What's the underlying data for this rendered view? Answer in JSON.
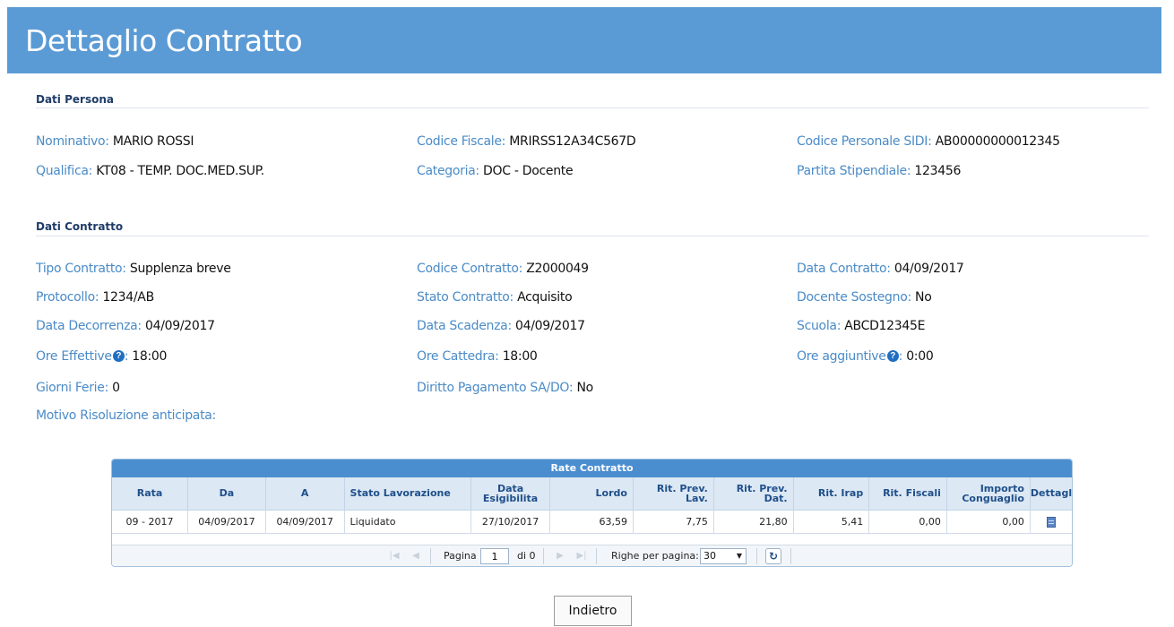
{
  "header": {
    "title": "Dettaglio Contratto"
  },
  "persona": {
    "section_title": "Dati Persona",
    "nominativo": {
      "label": "Nominativo:",
      "value": "MARIO ROSSI"
    },
    "codice_fiscale": {
      "label": "Codice Fiscale:",
      "value": "MRIRSS12A34C567D"
    },
    "codice_sidi": {
      "label": "Codice Personale SIDI:",
      "value": "AB00000000012345"
    },
    "qualifica": {
      "label": "Qualifica:",
      "value": "KT08 - TEMP. DOC.MED.SUP."
    },
    "categoria": {
      "label": "Categoria:",
      "value": "DOC - Docente"
    },
    "partita": {
      "label": "Partita Stipendiale:",
      "value": "123456"
    }
  },
  "contratto": {
    "section_title": "Dati Contratto",
    "tipo": {
      "label": "Tipo Contratto:",
      "value": "Supplenza breve"
    },
    "codice": {
      "label": "Codice Contratto:",
      "value": "Z2000049"
    },
    "data_contratto": {
      "label": "Data Contratto:",
      "value": "04/09/2017"
    },
    "protocollo": {
      "label": "Protocollo:",
      "value": "1234/AB"
    },
    "stato": {
      "label": "Stato Contratto:",
      "value": "Acquisito"
    },
    "sostegno": {
      "label": "Docente Sostegno:",
      "value": "No"
    },
    "decorrenza": {
      "label": "Data Decorrenza:",
      "value": "04/09/2017"
    },
    "scadenza": {
      "label": "Data Scadenza:",
      "value": "04/09/2017"
    },
    "scuola": {
      "label": "Scuola:",
      "value": "ABCD12345E"
    },
    "ore_effettive": {
      "label": "Ore Effettive",
      "suffix": ":",
      "value": "18:00"
    },
    "ore_cattedra": {
      "label": "Ore Cattedra:",
      "value": "18:00"
    },
    "ore_aggiuntive": {
      "label": "Ore aggiuntive",
      "suffix": ":",
      "value": "0:00"
    },
    "giorni_ferie": {
      "label": "Giorni Ferie:",
      "value": "0"
    },
    "diritto": {
      "label": "Diritto Pagamento SA/DO:",
      "value": "No"
    },
    "motivo": {
      "label": "Motivo Risoluzione anticipata:",
      "value": ""
    }
  },
  "help_glyph": "?",
  "rate": {
    "caption": "Rate Contratto",
    "columns": [
      "Rata",
      "Da",
      "A",
      "Stato Lavorazione",
      "Data Esigibilita",
      "Lordo",
      "Rit. Prev. Lav.",
      "Rit. Prev. Dat.",
      "Rit. Irap",
      "Rit. Fiscali",
      "Importo Conguaglio",
      "Dettaglio"
    ],
    "rows": [
      [
        "09 - 2017",
        "04/09/2017",
        "04/09/2017",
        "Liquidato",
        "27/10/2017",
        "63,59",
        "7,75",
        "21,80",
        "5,41",
        "0,00",
        "0,00"
      ]
    ],
    "pager": {
      "page_label": "Pagina",
      "page_value": "1",
      "of_label": "di 0",
      "rows_label": "Righe per pagina:",
      "rows_value": "30"
    }
  },
  "footer": {
    "back_label": "Indietro"
  }
}
